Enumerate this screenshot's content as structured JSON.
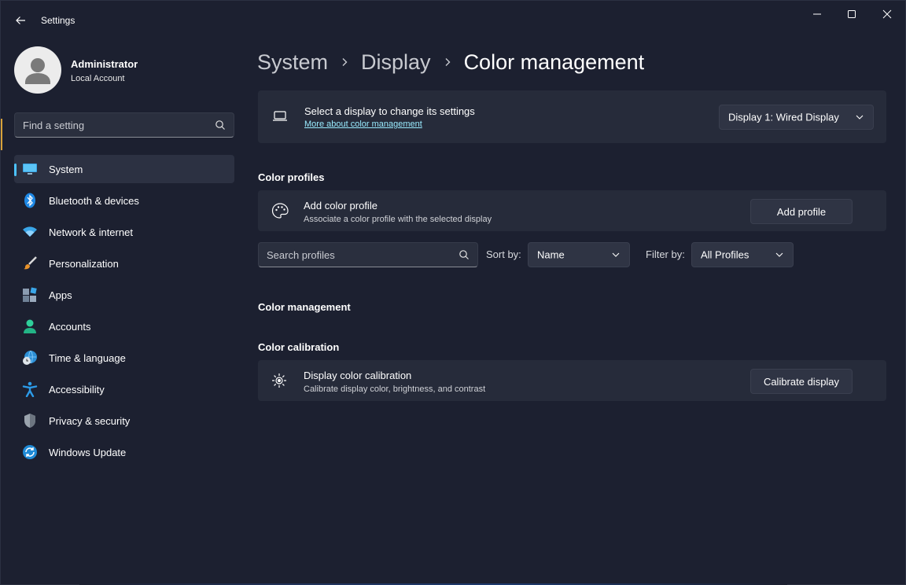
{
  "window": {
    "title": "Settings"
  },
  "user": {
    "name": "Administrator",
    "account_type": "Local Account"
  },
  "search": {
    "placeholder": "Find a setting"
  },
  "sidebar": {
    "items": [
      {
        "label": "System",
        "icon": "monitor-icon",
        "selected": true
      },
      {
        "label": "Bluetooth & devices",
        "icon": "bluetooth-icon"
      },
      {
        "label": "Network & internet",
        "icon": "wifi-icon"
      },
      {
        "label": "Personalization",
        "icon": "brush-icon"
      },
      {
        "label": "Apps",
        "icon": "apps-icon"
      },
      {
        "label": "Accounts",
        "icon": "person-icon"
      },
      {
        "label": "Time & language",
        "icon": "globe-clock-icon"
      },
      {
        "label": "Accessibility",
        "icon": "accessibility-icon"
      },
      {
        "label": "Privacy & security",
        "icon": "shield-icon"
      },
      {
        "label": "Windows Update",
        "icon": "update-icon"
      }
    ]
  },
  "breadcrumb": {
    "items": [
      "System",
      "Display",
      "Color management"
    ]
  },
  "display_select": {
    "title": "Select a display to change its settings",
    "link": "More about color management",
    "selected": "Display 1: Wired Display"
  },
  "color_profiles": {
    "heading": "Color profiles",
    "add_title": "Add color profile",
    "add_subtitle": "Associate a color profile with the selected display",
    "add_button": "Add profile",
    "search_placeholder": "Search profiles",
    "sort_label": "Sort by:",
    "sort_value": "Name",
    "filter_label": "Filter by:",
    "filter_value": "All Profiles"
  },
  "color_management": {
    "heading": "Color management"
  },
  "color_calibration": {
    "heading": "Color calibration",
    "title": "Display color calibration",
    "subtitle": "Calibrate display color, brightness, and contrast",
    "button": "Calibrate display"
  },
  "colors": {
    "accent": "#4cc2ff",
    "background": "#1c2030",
    "card": "#262b3a"
  }
}
